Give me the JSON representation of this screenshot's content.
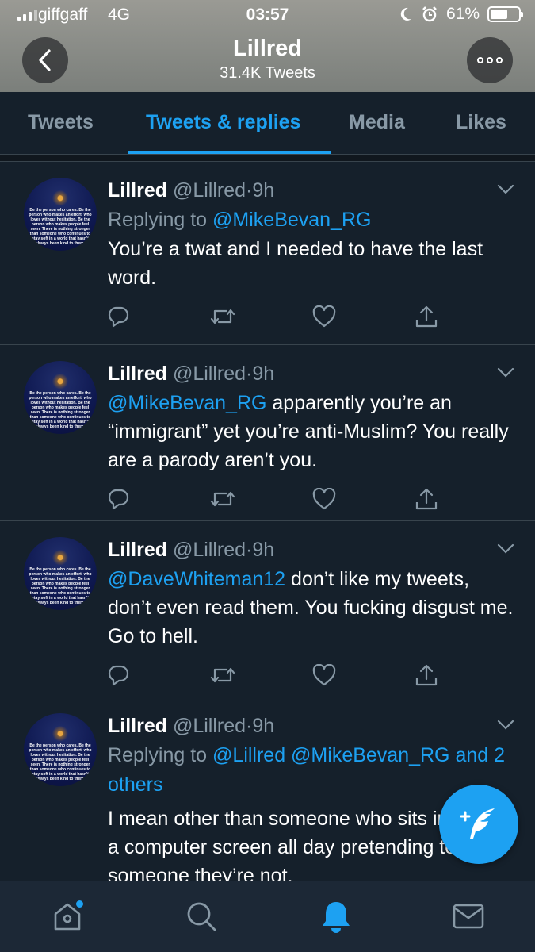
{
  "status_bar": {
    "carrier": "giffgaff",
    "network": "4G",
    "time": "03:57",
    "battery_percent": "61%",
    "battery_level": 0.61
  },
  "header": {
    "name": "Lillred",
    "tweet_count": "31.4K Tweets"
  },
  "tabs": [
    {
      "label": "Tweets",
      "active": false
    },
    {
      "label": "Tweets & replies",
      "active": true
    },
    {
      "label": "Media",
      "active": false
    },
    {
      "label": "Likes",
      "active": false
    }
  ],
  "avatar_text": "Be the person who cares. Be the person who makes an effort, who loves without hesitation. Be the person who makes people feel seen. There is nothing stronger than someone who continues to stay soft in a world that hasn't always been kind to them.",
  "tweets": [
    {
      "name": "Lillred",
      "handle": "@Lillred",
      "sep": "·",
      "time": "9h",
      "replying_prefix": "Replying to",
      "replying_to": "@MikeBevan_RG",
      "mention": "",
      "text": "You’re a twat and I needed to have the last word."
    },
    {
      "name": "Lillred",
      "handle": "@Lillred",
      "sep": "·",
      "time": "9h",
      "mention": "@MikeBevan_RG",
      "text": " apparently you’re an “immigrant” yet you’re anti-Muslim? You really are a parody aren’t you."
    },
    {
      "name": "Lillred",
      "handle": "@Lillred",
      "sep": "·",
      "time": "9h",
      "mention": "@DaveWhiteman12",
      "text": " don’t like my tweets, don’t even read them. You fucking disgust me. Go to hell."
    },
    {
      "name": "Lillred",
      "handle": "@Lillred",
      "sep": "·",
      "time": "9h",
      "replying_prefix": "Replying to",
      "replying_to": "@Lillred @MikeBevan_RG",
      "replying_more": "and 2 others",
      "text": "I mean other than someone who sits in front of a computer screen all day pretending to be someone they’re not."
    }
  ],
  "colors": {
    "background": "#15202b",
    "accent": "#1da1f2",
    "muted": "#8899a6"
  },
  "icons": {
    "actions": [
      "reply-icon",
      "retweet-icon",
      "like-icon",
      "share-icon"
    ],
    "nav": [
      "home-icon",
      "search-icon",
      "notifications-icon",
      "messages-icon"
    ],
    "fab": "compose-tweet-icon"
  }
}
